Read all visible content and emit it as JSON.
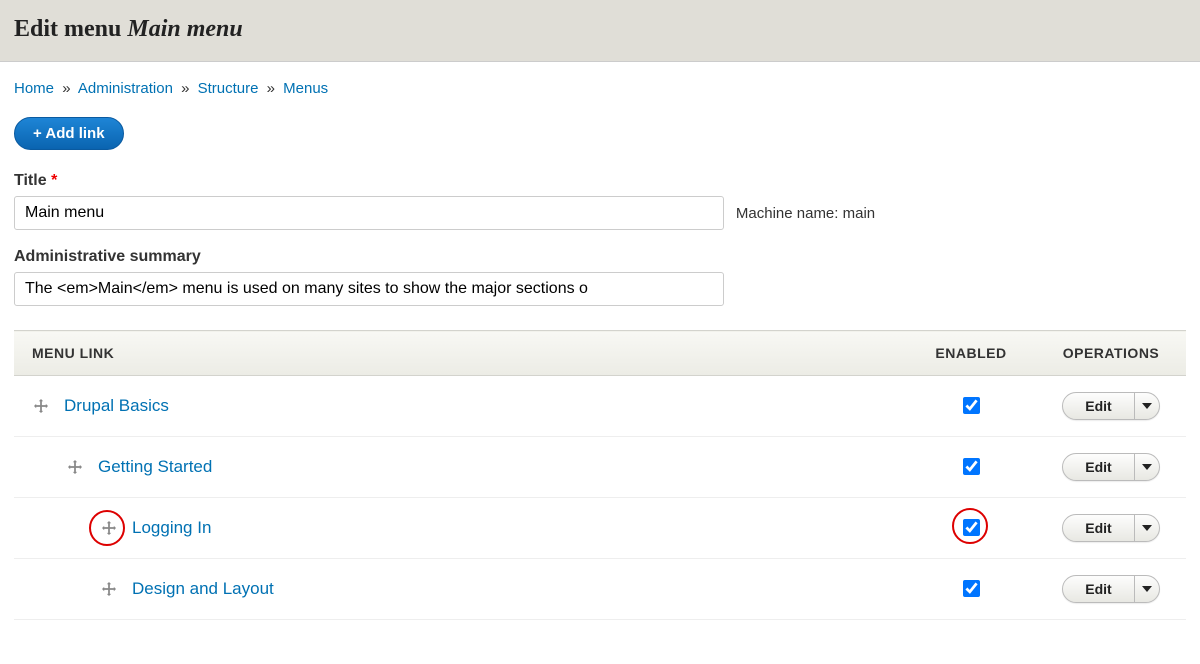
{
  "header": {
    "title_prefix": "Edit menu ",
    "title_emphasis": "Main menu"
  },
  "breadcrumb": {
    "items": [
      {
        "label": "Home"
      },
      {
        "label": "Administration"
      },
      {
        "label": "Structure"
      },
      {
        "label": "Menus"
      }
    ],
    "separator": "»"
  },
  "add_link_button": "+ Add link",
  "title_field": {
    "label": "Title",
    "value": "Main menu",
    "required": true,
    "machine_name_prefix": "Machine name: ",
    "machine_name": "main"
  },
  "summary_field": {
    "label": "Administrative summary",
    "value": "The <em>Main</em> menu is used on many sites to show the major sections o"
  },
  "table": {
    "headers": {
      "link": "MENU LINK",
      "enabled": "ENABLED",
      "operations": "OPERATIONS"
    },
    "edit_label": "Edit",
    "rows": [
      {
        "label": "Drupal Basics",
        "indent": 0,
        "enabled": true,
        "highlighted": false
      },
      {
        "label": "Getting Started",
        "indent": 1,
        "enabled": true,
        "highlighted": false
      },
      {
        "label": "Logging In",
        "indent": 2,
        "enabled": true,
        "highlighted": true
      },
      {
        "label": "Design and Layout",
        "indent": 2,
        "enabled": true,
        "highlighted": false
      }
    ]
  }
}
